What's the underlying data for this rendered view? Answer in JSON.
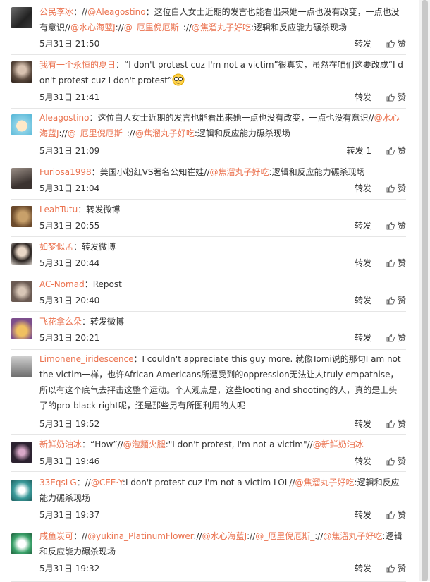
{
  "ui": {
    "forward": "转发",
    "like": "赞",
    "colors": {
      "link": "#eb7350",
      "text": "#333333",
      "divider": "#e6e6e6"
    }
  },
  "comments": [
    {
      "user": "公民李冰",
      "parts": [
        {
          "t": "：//",
          "c": "txt"
        },
        {
          "t": "@Aleagostino",
          "c": "mention"
        },
        {
          "t": "：这位白人女士近期的发言也能看出来她一点也没有改变，一点也没有意识//",
          "c": "txt"
        },
        {
          "t": "@水心海蓝J",
          "c": "mention"
        },
        {
          "t": "://",
          "c": "txt"
        },
        {
          "t": "@_厄里倪厄斯_",
          "c": "mention"
        },
        {
          "t": "://",
          "c": "txt"
        },
        {
          "t": "@焦溜丸子好吃",
          "c": "mention"
        },
        {
          "t": ":逻辑和反应能力碾杀现场",
          "c": "txt"
        }
      ],
      "time": "5月31日 21:50",
      "forward_count": "",
      "avatar": "dark-portrait"
    },
    {
      "user": "我有一个永恒的夏日",
      "parts": [
        {
          "t": "：“I don't protest cuz I'm not a victim”很真实，虽然在咱们这要改成“I don't protest cuz I don't protest”",
          "c": "txt"
        }
      ],
      "emoji": "glasses-emoji",
      "time": "5月31日 21:41",
      "forward_count": "",
      "avatar": "girl-portrait"
    },
    {
      "user": "Aleagostino",
      "parts": [
        {
          "t": "：这位白人女士近期的发言也能看出来她一点也没有改变，一点也没有意识//",
          "c": "txt"
        },
        {
          "t": "@水心海蓝J",
          "c": "mention"
        },
        {
          "t": "://",
          "c": "txt"
        },
        {
          "t": "@_厄里倪厄斯_",
          "c": "mention"
        },
        {
          "t": "://",
          "c": "txt"
        },
        {
          "t": "@焦溜丸子好吃",
          "c": "mention"
        },
        {
          "t": ":逻辑和反应能力碾杀现场",
          "c": "txt"
        }
      ],
      "time": "5月31日 21:09",
      "forward_count": "1",
      "avatar": "cartoon-face"
    },
    {
      "user": "Furiosa1998",
      "parts": [
        {
          "t": "：美国小粉红VS著名公知崔娃//",
          "c": "txt"
        },
        {
          "t": "@焦溜丸子好吃",
          "c": "mention"
        },
        {
          "t": ":逻辑和反应能力碾杀现场",
          "c": "txt"
        }
      ],
      "time": "5月31日 21:04",
      "forward_count": "",
      "avatar": "person-dark"
    },
    {
      "user": "LeahTutu",
      "parts": [
        {
          "t": "：转发微博",
          "c": "txt"
        }
      ],
      "time": "5月31日 20:55",
      "forward_count": "",
      "avatar": "cat"
    },
    {
      "user": "如梦似孟",
      "parts": [
        {
          "t": "：转发微博",
          "c": "txt"
        }
      ],
      "time": "5月31日 20:44",
      "forward_count": "",
      "avatar": "woman-long-hair"
    },
    {
      "user": "AC-Nomad",
      "parts": [
        {
          "t": "：Repost",
          "c": "txt"
        }
      ],
      "time": "5月31日 20:40",
      "forward_count": "",
      "avatar": "blurred-face"
    },
    {
      "user": "飞花拿么朵",
      "parts": [
        {
          "t": "：转发微博",
          "c": "txt"
        }
      ],
      "time": "5月31日 20:21",
      "forward_count": "",
      "avatar": "cartoon-character"
    },
    {
      "user": "Limonene_iridescence",
      "parts": [
        {
          "t": "：I couldn't appreciate this guy more. 就像Tomi说的那句I am not the victim一样，也许African Americans所遭受到的oppression无法让人truly empathise，所以有这个底气去抨击这整个运动。个人观点是，这些looting and shooting的人，真的是上头了的pro-black right呢，还是那些另有所图利用的人呢",
          "c": "txt"
        }
      ],
      "time": "5月31日 19:52",
      "forward_count": "",
      "avatar": "sketch-figure"
    },
    {
      "user": "新鲜奶油冰",
      "parts": [
        {
          "t": "：“How”//",
          "c": "txt"
        },
        {
          "t": "@泡麵火腿",
          "c": "mention"
        },
        {
          "t": ":\"I don't protest, I'm not a victim\"//",
          "c": "txt"
        },
        {
          "t": "@新鲜奶油冰",
          "c": "mention"
        }
      ],
      "time": "5月31日 19:46",
      "forward_count": "",
      "avatar": "anime-dark"
    },
    {
      "user": "33EqsLG",
      "parts": [
        {
          "t": "：//",
          "c": "txt"
        },
        {
          "t": "@CEE·Y",
          "c": "mention"
        },
        {
          "t": ":I don't protest cuz I'm not a victim LOL//",
          "c": "txt"
        },
        {
          "t": "@焦溜丸子好吃",
          "c": "mention"
        },
        {
          "t": ":逻辑和反应能力碾杀现场",
          "c": "txt"
        }
      ],
      "time": "5月31日 19:37",
      "forward_count": "",
      "avatar": "teal-character"
    },
    {
      "user": "咸鱼炭可",
      "parts": [
        {
          "t": "：//",
          "c": "txt"
        },
        {
          "t": "@yukina_PlatinumFlower",
          "c": "mention"
        },
        {
          "t": "://",
          "c": "txt"
        },
        {
          "t": "@水心海蓝J",
          "c": "mention"
        },
        {
          "t": "://",
          "c": "txt"
        },
        {
          "t": "@_厄里倪厄斯_",
          "c": "mention"
        },
        {
          "t": "://",
          "c": "txt"
        },
        {
          "t": "@焦溜丸子好吃",
          "c": "mention"
        },
        {
          "t": ":逻辑和反应能力碾杀现场",
          "c": "txt"
        }
      ],
      "time": "5月31日 19:32",
      "forward_count": "",
      "avatar": "green-mask"
    }
  ]
}
